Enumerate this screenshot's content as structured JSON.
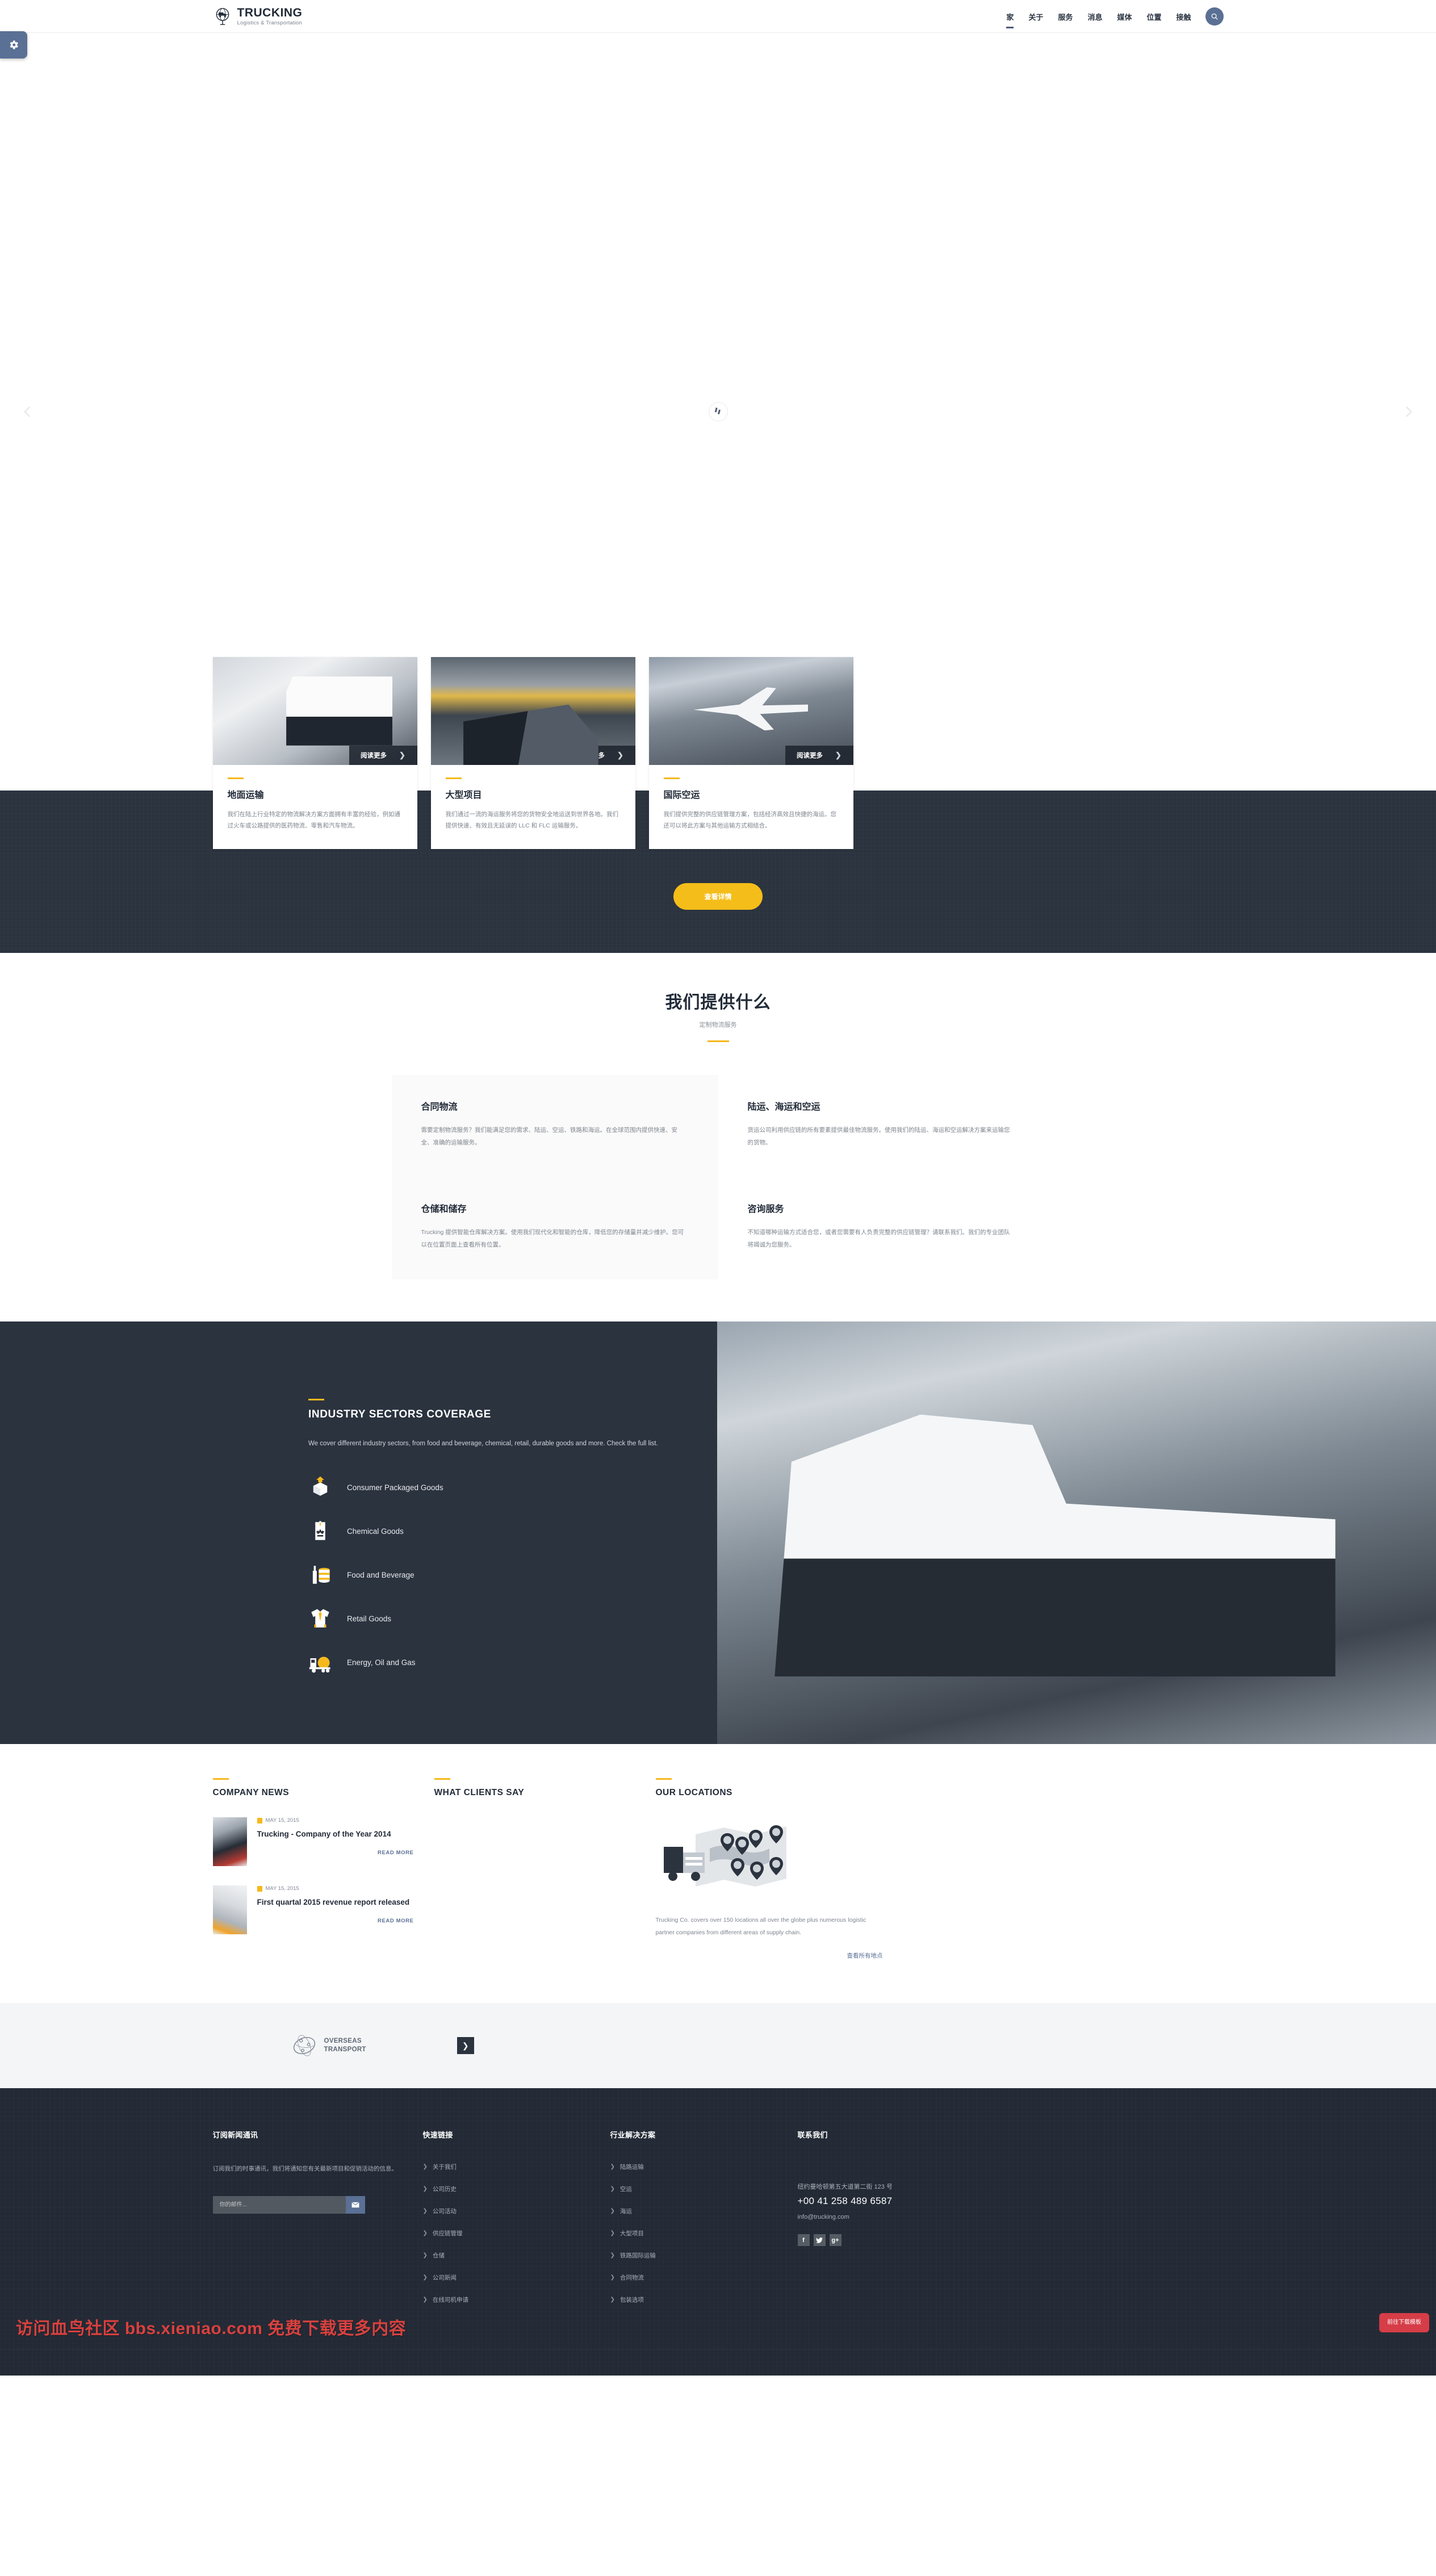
{
  "side_tab": {
    "icon": "gear-icon"
  },
  "header": {
    "logo": {
      "title": "TRUCKING",
      "tagline": "Logistics & Transportation",
      "icon": "globe-truck-logo-icon"
    },
    "nav": [
      {
        "label": "家",
        "active": true
      },
      {
        "label": "关于",
        "active": false
      },
      {
        "label": "服务",
        "active": false
      },
      {
        "label": "消息",
        "active": false
      },
      {
        "label": "媒体",
        "active": false
      },
      {
        "label": "位置",
        "active": false
      },
      {
        "label": "接触",
        "active": false
      }
    ],
    "search_icon": "search-icon"
  },
  "hero": {
    "loading": "spinner-icon",
    "prev_icon": "chevron-left-icon",
    "next_icon": "chevron-right-icon"
  },
  "service_cards": [
    {
      "image": "truck-on-highway-photo",
      "read_more": "阅读更多",
      "title": "地面运输",
      "text": "我们在陆上行业特定的物流解决方案方面拥有丰富的经验，例如通过火车或公路提供的医药物流、零售和汽车物流。"
    },
    {
      "image": "cargo-ship-photo",
      "read_more": "阅读更多",
      "title": "大型项目",
      "text": "我们通过一流的海运服务将您的货物安全地运送到世界各地。我们提供快速、有效且无延误的 LLC 和 FLC 运输服务。"
    },
    {
      "image": "airplane-photo",
      "read_more": "阅读更多",
      "title": "国际空运",
      "text": "我们提供完整的供应链管理方案，包括经济高效且快捷的海运。您还可以将此方案与其他运输方式相结合。"
    }
  ],
  "band_button": {
    "label": "查看详情"
  },
  "offer": {
    "title": "我们提供什么",
    "subtitle": "定制物流服务",
    "items": [
      {
        "title": "合同物流",
        "text": "需要定制物流服务？我们能满足您的需求、陆运、空运、铁路和海运。在全球范围内提供快速、安全、准确的运输服务。"
      },
      {
        "title": "陆运、海运和空运",
        "text": "货运公司利用供应链的所有要素提供最佳物流服务。使用我们的陆运、海运和空运解决方案来运输您的货物。"
      },
      {
        "title": "仓储和储存",
        "text": "Trucking 提供智能仓库解决方案。使用我们现代化和智能的仓库，降低您的存储量并减少维护。您可以在位置页面上查看所有位置。"
      },
      {
        "title": "咨询服务",
        "text": "不知道哪种运输方式适合您，或者您需要有人负责完整的供应链管理？请联系我们。我们的专业团队将竭诚为您服务。"
      }
    ]
  },
  "sectors": {
    "title": "INDUSTRY SECTORS COVERAGE",
    "lede": "We cover different industry sectors, from food and beverage, chemical, retail, durable goods and more. Check the full list.",
    "items": [
      {
        "label": "Consumer Packaged Goods",
        "icon": "package-box-icon"
      },
      {
        "label": "Chemical Goods",
        "icon": "recycle-tag-icon"
      },
      {
        "label": "Food and Beverage",
        "icon": "bottle-can-icon"
      },
      {
        "label": "Retail Goods",
        "icon": "shirt-tie-icon"
      },
      {
        "label": "Energy, Oil and Gas",
        "icon": "tanker-truck-icon"
      }
    ],
    "photo": "big-rig-truck-photo"
  },
  "news": {
    "title": "COMPANY NEWS",
    "items": [
      {
        "date": "MAY 15, 2015",
        "title": "Trucking - Company of the Year 2014",
        "read_more": "READ MORE",
        "thumb": "truck-night-photo"
      },
      {
        "date": "MAY 15, 2015",
        "title": "First quartal 2015 revenue report released",
        "read_more": "READ MORE",
        "thumb": "financial-report-photo"
      }
    ]
  },
  "clients": {
    "title": "WHAT CLIENTS SAY"
  },
  "locations": {
    "title": "OUR LOCATIONS",
    "art": "world-map-with-truck-icon",
    "text": "Trucking Co. covers over 150 locations all over the globe plus numerous logistic partner companies from different areas of supply chain.",
    "link": "查看所有地点"
  },
  "partners": {
    "logo_line1": "OVERSEAS",
    "logo_line2": "TRANSPORT",
    "next_icon": "chevron-right-icon"
  },
  "footer": {
    "newsletter": {
      "title": "订阅新闻通讯",
      "text": "订阅我们的时事通讯，我们将通知您有关最新项目和促销活动的信息。",
      "placeholder": "你的邮件...",
      "value": "",
      "submit_icon": "envelope-icon"
    },
    "quick_links": {
      "title": "快速链接",
      "items": [
        "关于我们",
        "公司历史",
        "公司活动",
        "供应链管理",
        "仓储",
        "公司新闻",
        "在线司机申请"
      ]
    },
    "solutions": {
      "title": "行业解决方案",
      "items": [
        "陆路运输",
        "空运",
        "海运",
        "大型项目",
        "铁路国际运输",
        "合同物流",
        "包装选项"
      ]
    },
    "contact": {
      "title": "联系我们",
      "address": "纽约曼哈顿第五大道第二街 123 号",
      "phone": "+00 41 258 489 6587",
      "email": "info@trucking.com",
      "socials": [
        {
          "name": "facebook-icon",
          "glyph": "f"
        },
        {
          "name": "twitter-icon",
          "glyph": "🐦"
        },
        {
          "name": "google-plus-icon",
          "glyph": "g+"
        }
      ]
    }
  },
  "watermark": {
    "text": "访问血鸟社区 bbs.xieniao.com 免费下载更多内容"
  },
  "download_button": {
    "label": "前往下载模板"
  },
  "colors": {
    "accent_yellow": "#f5b91c",
    "dark": "#2b333f",
    "footer_dark": "#232a35",
    "blue": "#5a7094",
    "red": "#d63d47"
  }
}
